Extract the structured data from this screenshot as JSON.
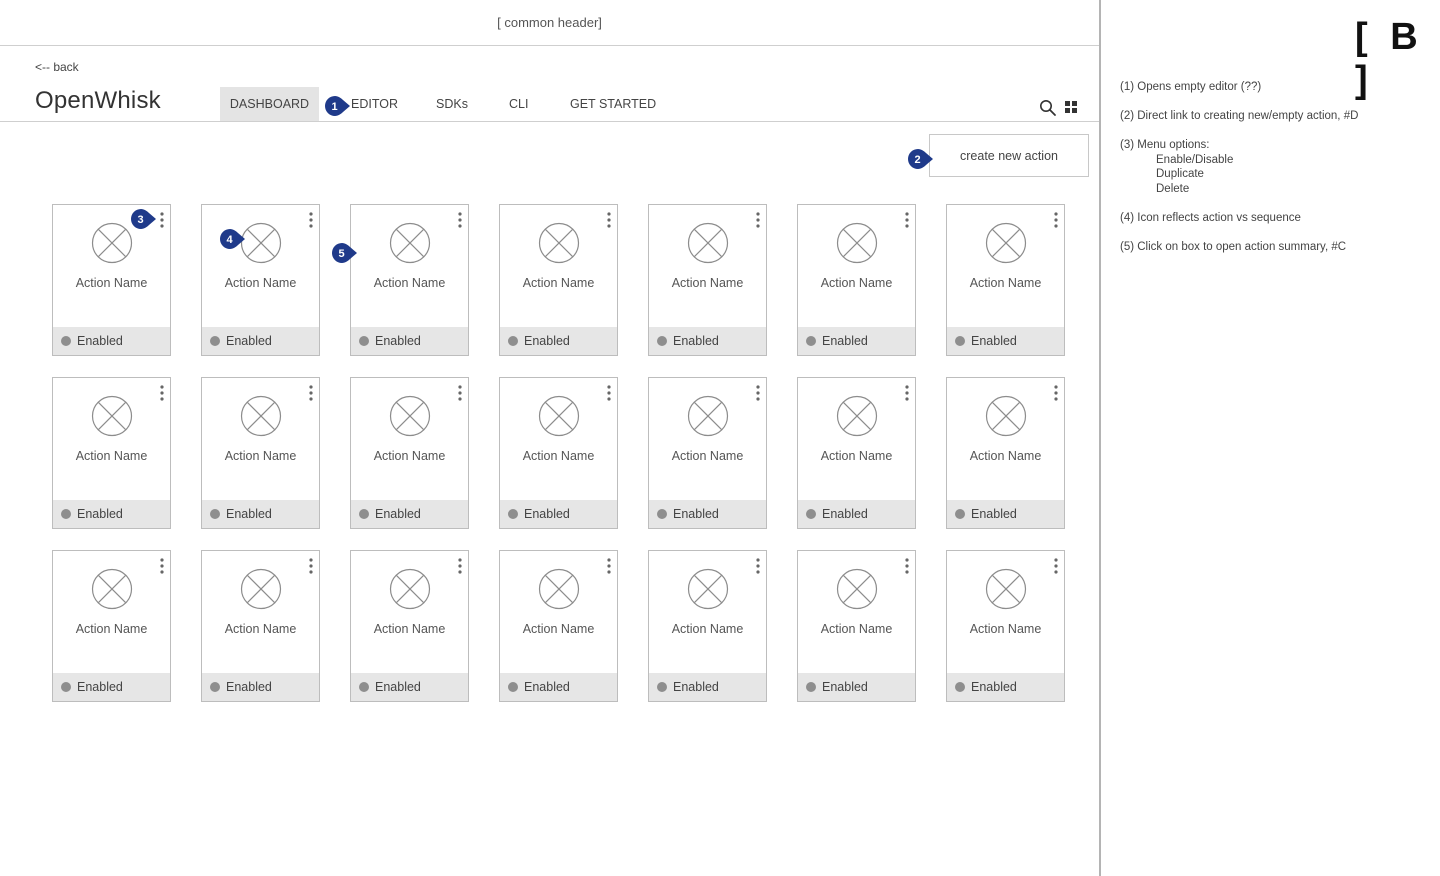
{
  "header": {
    "common_label": "[ common header]"
  },
  "nav": {
    "back": "<-- back",
    "app_title": "OpenWhisk",
    "tabs": [
      "DASHBOARD",
      "EDITOR",
      "SDKs",
      "CLI",
      "GET STARTED"
    ],
    "active_tab": "DASHBOARD"
  },
  "toolbar": {
    "search_icon": "search-icon",
    "grid_icon": "grid-view-icon",
    "create_label": "create new action"
  },
  "badges": [
    "1",
    "2",
    "3",
    "4",
    "5"
  ],
  "cards": [
    {
      "name": "Action Name",
      "status": "Enabled"
    },
    {
      "name": "Action Name",
      "status": "Enabled"
    },
    {
      "name": "Action Name",
      "status": "Enabled"
    },
    {
      "name": "Action Name",
      "status": "Enabled"
    },
    {
      "name": "Action Name",
      "status": "Enabled"
    },
    {
      "name": "Action Name",
      "status": "Enabled"
    },
    {
      "name": "Action Name",
      "status": "Enabled"
    },
    {
      "name": "Action Name",
      "status": "Enabled"
    },
    {
      "name": "Action Name",
      "status": "Enabled"
    },
    {
      "name": "Action Name",
      "status": "Enabled"
    },
    {
      "name": "Action Name",
      "status": "Enabled"
    },
    {
      "name": "Action Name",
      "status": "Enabled"
    },
    {
      "name": "Action Name",
      "status": "Enabled"
    },
    {
      "name": "Action Name",
      "status": "Enabled"
    },
    {
      "name": "Action Name",
      "status": "Enabled"
    },
    {
      "name": "Action Name",
      "status": "Enabled"
    },
    {
      "name": "Action Name",
      "status": "Enabled"
    },
    {
      "name": "Action Name",
      "status": "Enabled"
    },
    {
      "name": "Action Name",
      "status": "Enabled"
    },
    {
      "name": "Action Name",
      "status": "Enabled"
    },
    {
      "name": "Action Name",
      "status": "Enabled"
    }
  ],
  "annotations": {
    "title": "[ B ]",
    "notes": [
      {
        "text": "(1) Opens empty editor (??)",
        "sub": []
      },
      {
        "text": "(2) Direct link to creating new/empty action, #D",
        "sub": []
      },
      {
        "text": "(3) Menu options:",
        "sub": [
          "Enable/Disable",
          "Duplicate",
          "Delete"
        ]
      },
      {
        "text": "(4) Icon reflects action vs sequence",
        "sub": []
      },
      {
        "text": "(5) Click on box to open action summary, #C",
        "sub": []
      }
    ]
  },
  "colors": {
    "badge_fill": "#1f3a8a",
    "tab_active_bg": "#e4e4e4",
    "card_footer_bg": "#e6e6e6",
    "status_dot": "#8e8e8e"
  }
}
